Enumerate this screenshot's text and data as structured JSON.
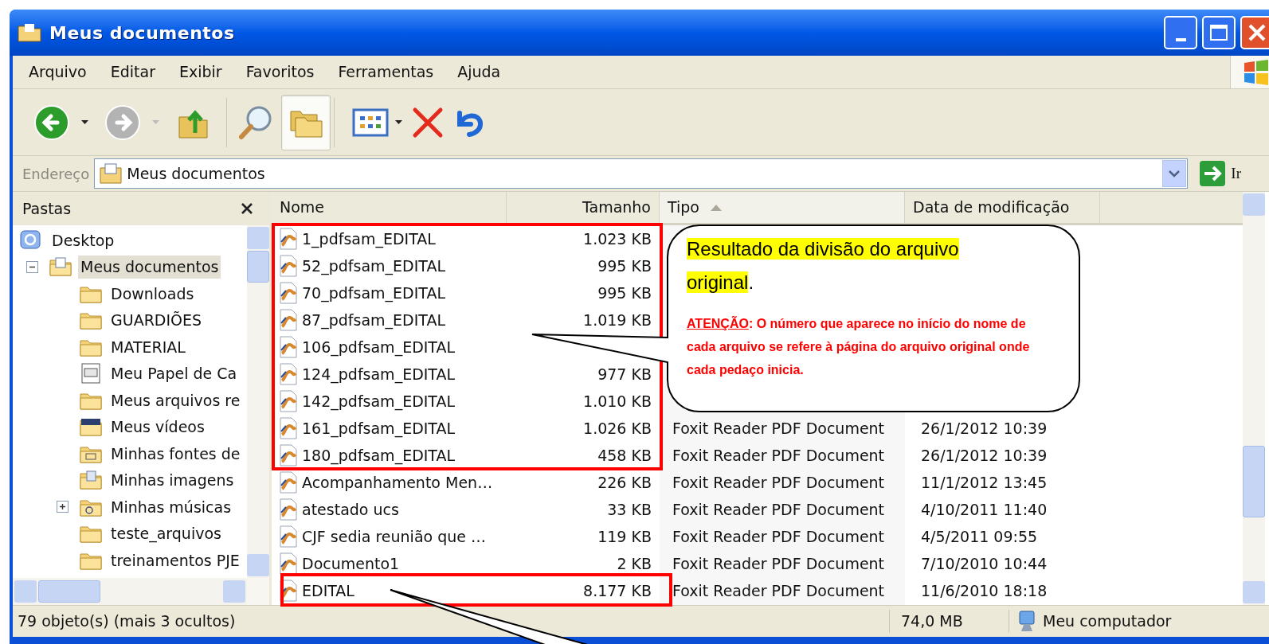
{
  "window": {
    "title": "Meus documentos"
  },
  "menu": [
    {
      "label": "Arquivo"
    },
    {
      "label": "Editar"
    },
    {
      "label": "Exibir"
    },
    {
      "label": "Favoritos"
    },
    {
      "label": "Ferramentas"
    },
    {
      "label": "Ajuda"
    }
  ],
  "toolbar": [
    {
      "kind": "back",
      "disabled": false,
      "selected": false
    },
    {
      "kind": "forward",
      "disabled": true,
      "selected": false
    },
    {
      "kind": "up",
      "selected": false
    },
    {
      "kind": "search",
      "selected": false
    },
    {
      "kind": "folders",
      "selected": true
    },
    {
      "kind": "views",
      "selected": false
    },
    {
      "kind": "delete",
      "selected": false
    },
    {
      "kind": "undo",
      "selected": false
    }
  ],
  "address": {
    "label": "Endereço",
    "value": "Meus documentos",
    "go": "Ir"
  },
  "folders_pane": {
    "title": "Pastas",
    "tree": [
      {
        "label": "Desktop",
        "kind": "desktop",
        "selected": false,
        "children": [
          {
            "label": "Meus documentos",
            "kind": "documents",
            "selected": true,
            "expanded": true,
            "children": [
              {
                "label": "Downloads",
                "kind": "folder",
                "selected": false
              },
              {
                "label": "GUARDIÕES",
                "kind": "folder",
                "selected": false
              },
              {
                "label": "MATERIAL",
                "kind": "folder",
                "selected": false
              },
              {
                "label": "Meu Papel de Ca",
                "kind": "calendar",
                "selected": false
              },
              {
                "label": "Meus arquivos re",
                "kind": "folder",
                "selected": false
              },
              {
                "label": "Meus vídeos",
                "kind": "video",
                "selected": false
              },
              {
                "label": "Minhas fontes de",
                "kind": "fonts",
                "selected": false
              },
              {
                "label": "Minhas imagens",
                "kind": "images",
                "selected": false
              },
              {
                "label": "Minhas músicas",
                "kind": "music",
                "selected": false,
                "expanded": false
              },
              {
                "label": "teste_arquivos",
                "kind": "folder",
                "selected": false
              },
              {
                "label": "treinamentos PJE",
                "kind": "folder",
                "selected": false
              }
            ]
          }
        ]
      }
    ]
  },
  "columns": [
    {
      "label": "Nome",
      "sorted": false
    },
    {
      "label": "Tamanho",
      "sorted": false
    },
    {
      "label": "Tipo",
      "sorted": true
    },
    {
      "label": "Data de modificação",
      "sorted": false
    }
  ],
  "rows": [
    {
      "name": "1_pdfsam_EDITAL",
      "size": "1.023 KB"
    },
    {
      "name": "52_pdfsam_EDITAL",
      "size": "995 KB"
    },
    {
      "name": "70_pdfsam_EDITAL",
      "size": "995 KB"
    },
    {
      "name": "87_pdfsam_EDITAL",
      "size": "1.019 KB"
    },
    {
      "name": "106_pdfsam_EDITAL"
    },
    {
      "name": "124_pdfsam_EDITAL",
      "size": "977 KB"
    },
    {
      "name": "142_pdfsam_EDITAL",
      "size": "1.010 KB"
    },
    {
      "name": "161_pdfsam_EDITAL",
      "size": "1.026 KB",
      "type": "Foxit Reader PDF Document",
      "modified": "26/1/2012 10:39"
    },
    {
      "name": "180_pdfsam_EDITAL",
      "size": "458 KB",
      "type": "Foxit Reader PDF Document",
      "modified": "26/1/2012 10:39"
    },
    {
      "name": "Acompanhamento Men…",
      "size": "226 KB",
      "type": "Foxit Reader PDF Document",
      "modified": "11/1/2012 13:45"
    },
    {
      "name": "atestado ucs",
      "size": "33 KB",
      "type": "Foxit Reader PDF Document",
      "modified": "4/10/2011 11:40"
    },
    {
      "name": "CJF sedia reunião que …",
      "size": "119 KB",
      "type": "Foxit Reader PDF Document",
      "modified": "4/5/2011 09:55"
    },
    {
      "name": "Documento1",
      "size": "2 KB",
      "type": "Foxit Reader PDF Document",
      "modified": "7/10/2010 10:44"
    },
    {
      "name": "EDITAL",
      "size": "8.177 KB",
      "type": "Foxit Reader PDF Document",
      "modified": "11/6/2010 18:18"
    }
  ],
  "status_bar": {
    "objects": "79 objeto(s) (mais 3 ocultos)",
    "size": "74,0 MB",
    "location": "Meu computador"
  },
  "callout": {
    "highlight": "Resultado da divisão do arquivo original",
    "after": ".",
    "warning_label": "ATENÇÃO",
    "warning_text": ":  O número que aparece no início do nome de cada arquivo se refere à página do arquivo original onde cada pedaço inicia."
  }
}
